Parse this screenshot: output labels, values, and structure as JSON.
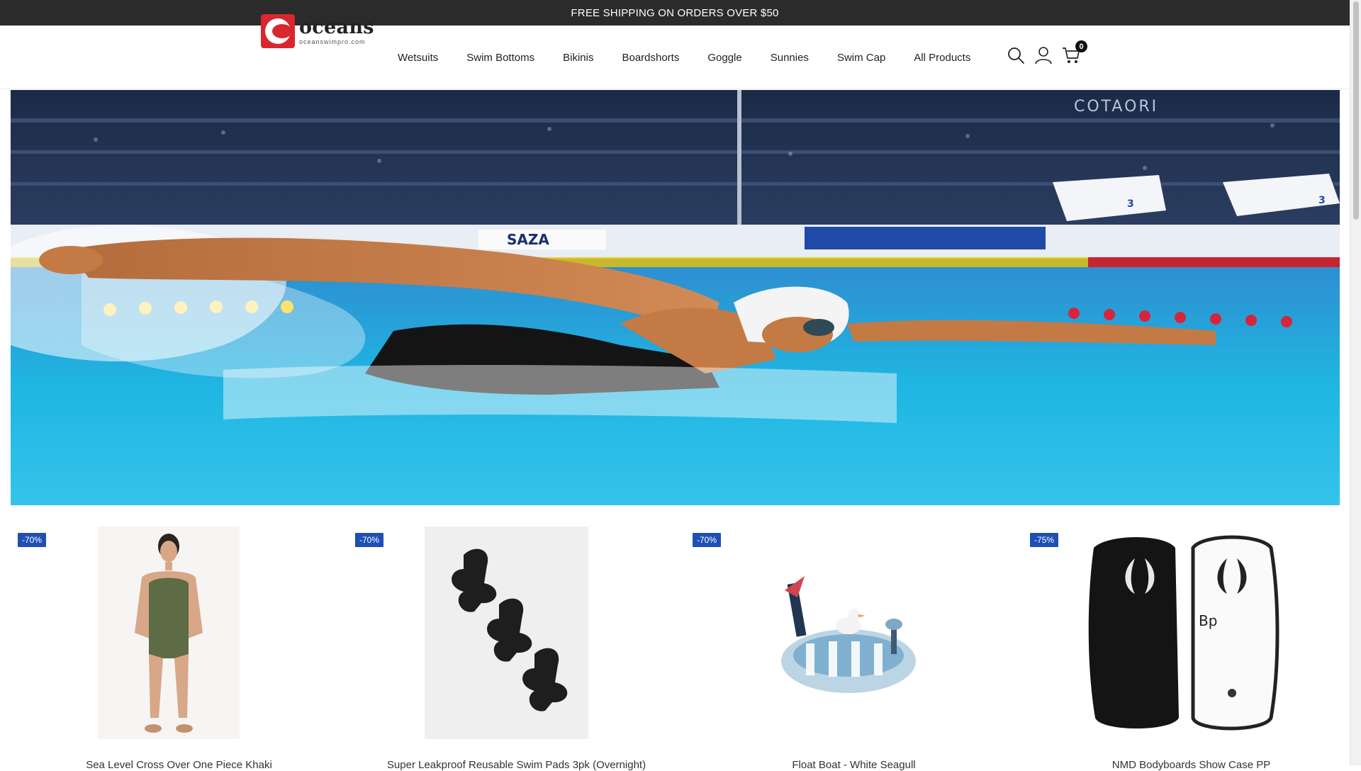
{
  "announcement": {
    "text": "FREE SHIPPING ON ORDERS OVER $50"
  },
  "header": {
    "logo": {
      "name": "oceans",
      "sub": "oceanswimpro.com",
      "color": "#d8272d"
    },
    "nav": [
      {
        "label": "Wetsuits"
      },
      {
        "label": "Swim Bottoms"
      },
      {
        "label": "Bikinis"
      },
      {
        "label": "Boardshorts"
      },
      {
        "label": "Goggle"
      },
      {
        "label": "Sunnies"
      },
      {
        "label": "Swim Cap"
      },
      {
        "label": "All Products"
      }
    ],
    "icons": [
      "search-icon",
      "account-icon",
      "cart-icon"
    ],
    "cart_count": "0"
  },
  "hero": {
    "image": "swimmer-freestyle-pool-photo",
    "banner_texts": [
      "COTAORI",
      "SAZA",
      "3",
      "3"
    ]
  },
  "products": [
    {
      "discount": "-70%",
      "title": "Sea Level Cross Over One Piece Khaki",
      "image": "khaki-one-piece-swimsuit"
    },
    {
      "discount": "-70%",
      "title": "Super Leakproof Reusable Swim Pads 3pk (Overnight)",
      "image": "black-reusable-pads"
    },
    {
      "discount": "-70%",
      "title": "Float Boat - White Seagull",
      "image": "inflatable-float-boat"
    },
    {
      "discount": "-75%",
      "title": "NMD Bodyboards Show Case PP",
      "image": "black-white-bodyboards"
    }
  ],
  "colors": {
    "accent": "#1f4fb4",
    "announcement_bg": "#2b2b2b",
    "brand_red": "#d8272d"
  }
}
